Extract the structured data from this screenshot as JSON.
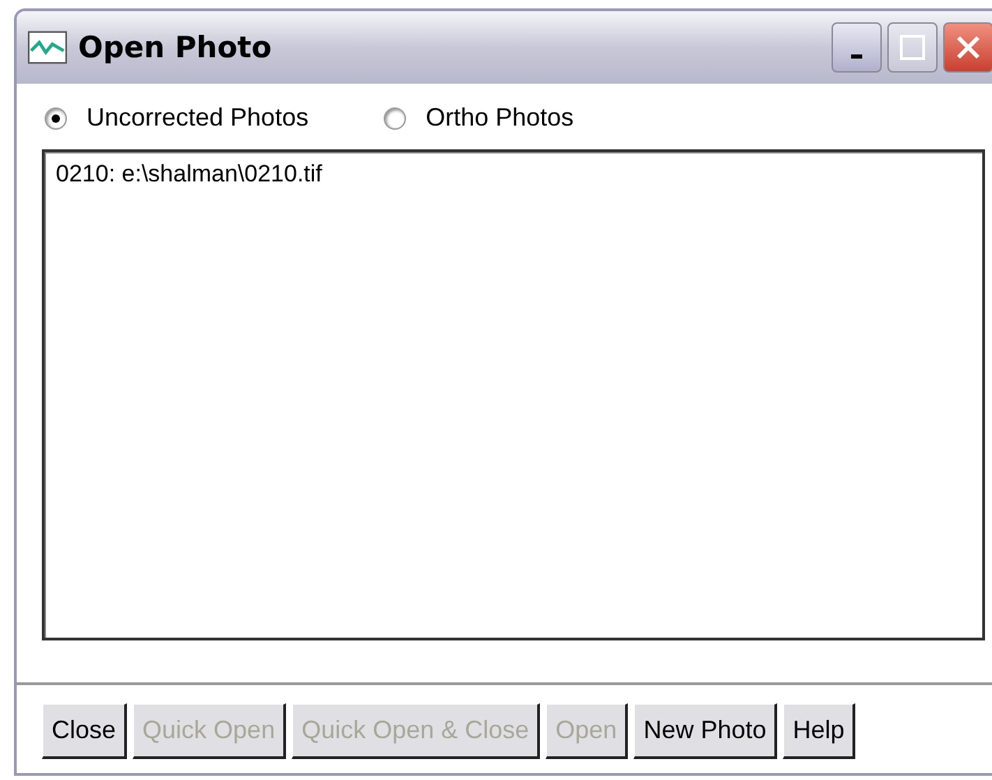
{
  "window": {
    "title": "Open Photo"
  },
  "radios": [
    {
      "label": "Uncorrected Photos",
      "selected": true
    },
    {
      "label": "Ortho Photos",
      "selected": false
    }
  ],
  "list": {
    "items": [
      {
        "text": "0210: e:\\shalman\\0210.tif",
        "selected": false
      }
    ]
  },
  "buttons": [
    {
      "label": "Close",
      "disabled": false
    },
    {
      "label": "Quick Open",
      "disabled": true
    },
    {
      "label": "Quick Open & Close",
      "disabled": true
    },
    {
      "label": "Open",
      "disabled": true
    },
    {
      "label": "New Photo",
      "disabled": false
    },
    {
      "label": "Help",
      "disabled": false
    }
  ]
}
